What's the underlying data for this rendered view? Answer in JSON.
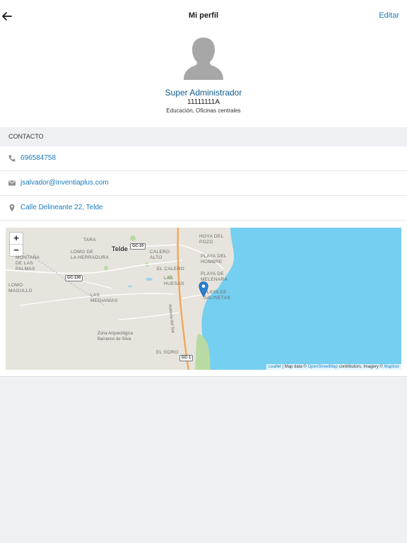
{
  "navbar": {
    "title": "Mi perfil",
    "edit_label": "Editar"
  },
  "profile": {
    "name": "Super Administrador",
    "id": "11111111A",
    "department": "Educación, Oficinas centrales"
  },
  "contact": {
    "header": "CONTACTO",
    "phone": "696584758",
    "email": "jsalvador@inventiaplus.com",
    "address": "Calle Delineante 22, Telde"
  },
  "map": {
    "zoom_in": "+",
    "zoom_out": "−",
    "labels": {
      "tara": "TARA",
      "telde": "Telde",
      "lomo_herradura": "LOMO DE\nLA HERRADURA",
      "montana_palmas": "MONTAÑA\nDE LAS\nPALMAS",
      "lomo_magullo": "LOMO\nMAGULLO",
      "las_medianias": "LAS\nMEDIANÍAS",
      "calero_alto": "CALERO\nALTO",
      "el_calero": "EL CALERO",
      "las_huesas": "LAS\nHUESAS",
      "hoya_pozo": "HOYA DEL\nPOZO",
      "playa_hombre": "PLAYA DEL\nHOMBRE",
      "playa_melenara": "PLAYA DE\nMELENARA",
      "salinetas": "PLAYA DE\nSALINETAS",
      "el_goro": "EL GORO",
      "zona_arqueologica": "Zona Arqueológica\nBarranco de Silva",
      "autovia": "Autovía del Sur"
    },
    "shields": {
      "gc10": "GC-10",
      "gc130": "GC-130",
      "gc1": "GC-1"
    },
    "attribution": {
      "leaflet": "Leaflet",
      "sep1": " | Map data © ",
      "osm": "OpenStreetMap",
      "sep2": " contributors, Imagery © ",
      "mapbox": "Mapbox"
    }
  },
  "colors": {
    "accent": "#1a7bbf",
    "name": "#0e5a8a",
    "water": "#75cff0",
    "land": "#e7e4dd",
    "road": "#f2a65a",
    "marker": "#2a7fd4",
    "background": "#eef0f3"
  },
  "icons": {
    "back": "arrow-left-icon",
    "avatar": "person-silhouette-icon",
    "phone": "phone-icon",
    "email": "envelope-icon",
    "address": "map-pin-icon",
    "marker": "map-marker-icon"
  }
}
